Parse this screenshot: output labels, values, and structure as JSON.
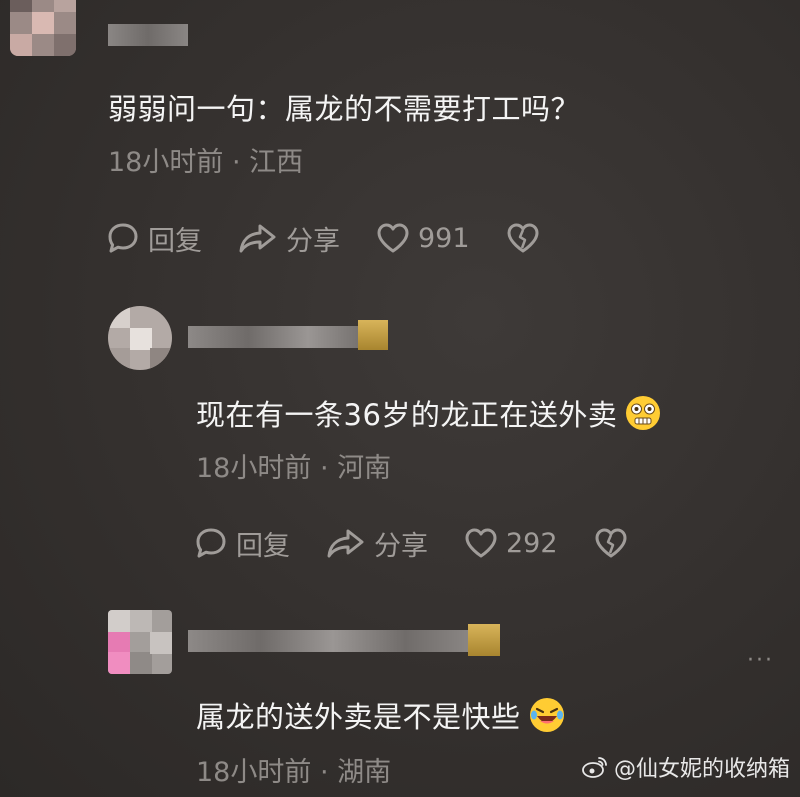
{
  "comments": [
    {
      "text": "弱弱问一句：属龙的不需要打工吗？",
      "meta": "18小时前 · 江西",
      "reply_label": "回复",
      "share_label": "分享",
      "likes": "991"
    },
    {
      "text": "现在有一条36岁的龙正在送外卖",
      "meta": "18小时前 · 河南",
      "reply_label": "回复",
      "share_label": "分享",
      "likes": "292"
    },
    {
      "text": "属龙的送外卖是不是快些",
      "meta": "18小时前 · 湖南"
    }
  ],
  "watermark": "@仙女妮的收纳箱",
  "more_icon": "···",
  "icons": [
    "reply-icon",
    "share-icon",
    "like-heart-icon",
    "dislike-heart-icon",
    "flushed-emoji-icon",
    "laughing-emoji-icon",
    "weibo-logo-icon",
    "more-icon"
  ]
}
